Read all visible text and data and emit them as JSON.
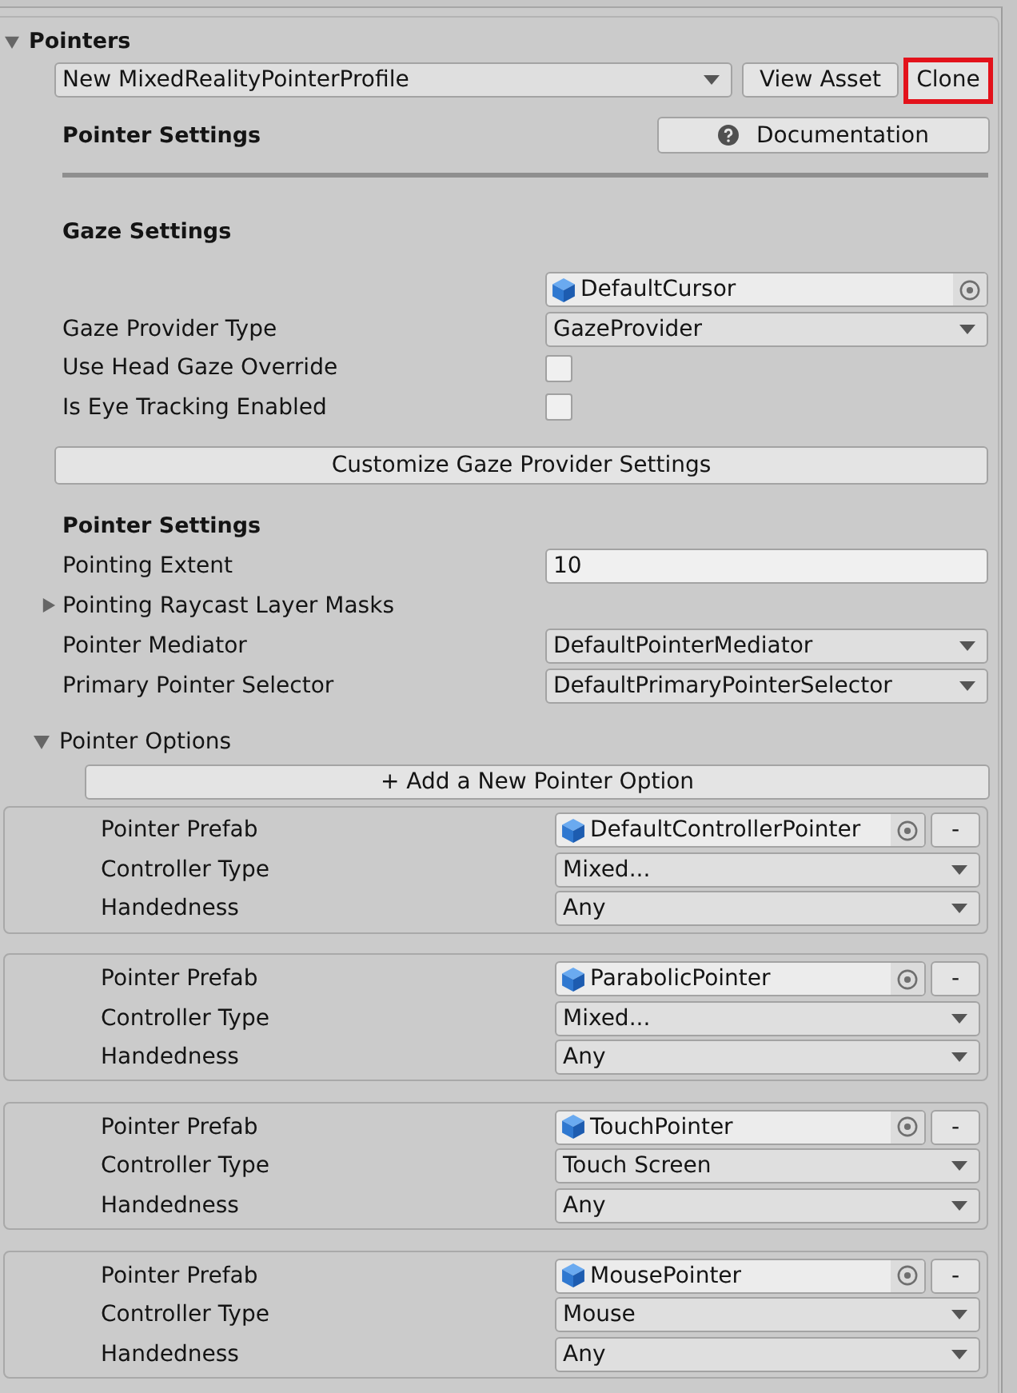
{
  "section": {
    "title": "Pointers",
    "expanded": true
  },
  "profile": {
    "dropdown": "New MixedRealityPointerProfile",
    "buttons": [
      {
        "label": "View Asset",
        "highlighted": false
      },
      {
        "label": "Clone",
        "highlighted": true
      }
    ]
  },
  "header": {
    "title": "Pointer Settings",
    "doc_button": "Documentation"
  },
  "gaze": {
    "title": "Gaze Settings",
    "rows": [
      {
        "kind": "object",
        "value": "DefaultCursor"
      },
      {
        "kind": "dropdown",
        "label": "Gaze Provider Type",
        "value": "GazeProvider"
      },
      {
        "kind": "checkbox",
        "label": "Use Head Gaze Override",
        "checked": false
      },
      {
        "kind": "checkbox",
        "label": "Is Eye Tracking Enabled",
        "checked": false
      }
    ],
    "button": "Customize Gaze Provider Settings"
  },
  "pointer_settings": {
    "title": "Pointer Settings",
    "rows": [
      {
        "kind": "number",
        "label": "Pointing Extent",
        "value": "10"
      },
      {
        "kind": "foldout",
        "label": "Pointing Raycast Layer Masks",
        "expanded": false
      },
      {
        "kind": "dropdown",
        "label": "Pointer Mediator",
        "value": "DefaultPointerMediator"
      },
      {
        "kind": "dropdown",
        "label": "Primary Pointer Selector",
        "value": "DefaultPrimaryPointerSelector"
      }
    ]
  },
  "pointer_options": {
    "title": "Pointer Options",
    "expanded": true,
    "add_button": "+ Add a New Pointer Option",
    "items": [
      {
        "prefab_label": "Pointer Prefab",
        "prefab": "DefaultControllerPointer",
        "remove_button": "-",
        "controller_label": "Controller Type",
        "controller_type": "Mixed...",
        "handedness_label": "Handedness",
        "handedness": "Any"
      },
      {
        "prefab_label": "Pointer Prefab",
        "prefab": "ParabolicPointer",
        "remove_button": "-",
        "controller_label": "Controller Type",
        "controller_type": "Mixed...",
        "handedness_label": "Handedness",
        "handedness": "Any"
      },
      {
        "prefab_label": "Pointer Prefab",
        "prefab": "TouchPointer",
        "remove_button": "-",
        "controller_label": "Controller Type",
        "controller_type": "Touch Screen",
        "handedness_label": "Handedness",
        "handedness": "Any"
      },
      {
        "prefab_label": "Pointer Prefab",
        "prefab": "MousePointer",
        "remove_button": "-",
        "controller_label": "Controller Type",
        "controller_type": "Mouse",
        "handedness_label": "Handedness",
        "handedness": "Any"
      }
    ]
  }
}
